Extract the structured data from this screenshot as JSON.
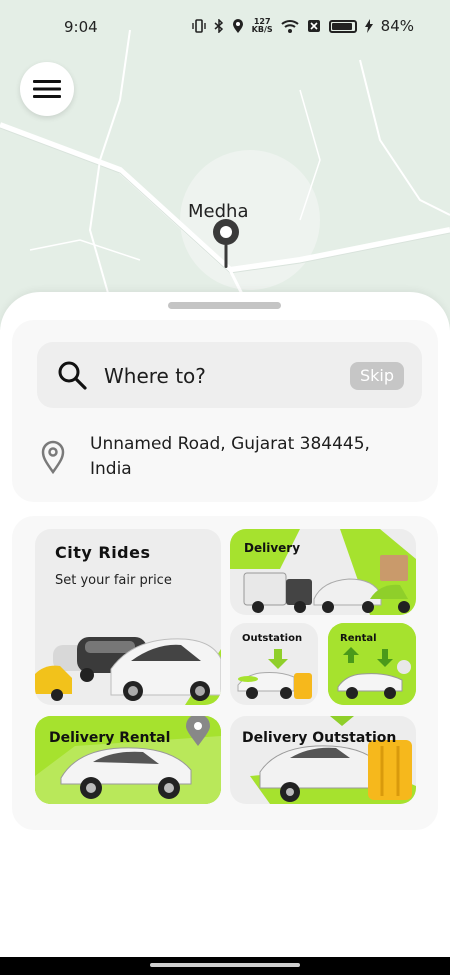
{
  "status_bar": {
    "time": "9:04",
    "speed_value": "127",
    "speed_unit": "KB/S",
    "battery": "84%"
  },
  "map": {
    "place_label": "Medha"
  },
  "search": {
    "placeholder": "Where to?",
    "skip_label": "Skip"
  },
  "location": {
    "address": "Unnamed Road, Gujarat 384445, India"
  },
  "services": {
    "city_rides": {
      "title": "City Rides",
      "subtitle": "Set your fair price"
    },
    "delivery": {
      "title": "Delivery"
    },
    "outstation": {
      "title": "Outstation"
    },
    "rental": {
      "title": "Rental"
    },
    "delivery_rental": {
      "title": "Delivery Rental"
    },
    "delivery_outstation": {
      "title": "Delivery Outstation"
    }
  },
  "colors": {
    "accent_green": "#a6e22e",
    "map_bg": "#e4eee6",
    "card_bg": "#f8f8f8"
  },
  "icons": [
    "menu-icon",
    "search-icon",
    "location-pin-icon",
    "map-pin-icon",
    "vibrate-icon",
    "bluetooth-icon",
    "location-status-icon",
    "wifi-icon",
    "battery-icon",
    "charging-icon"
  ]
}
